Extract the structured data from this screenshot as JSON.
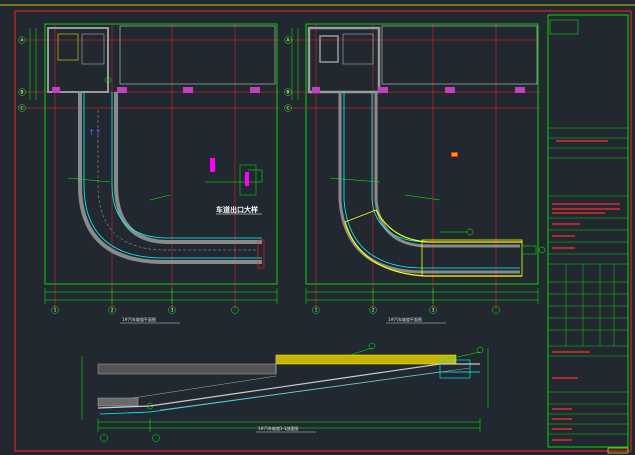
{
  "drawing": {
    "detail_callout": "车道出口大样",
    "plan_left_title": "1#汽车坡道平面图",
    "plan_right_title": "1#汽车坡道平面图",
    "section_title": "1#汽车坡道1-1剖面图",
    "axis_marks_left": [
      "A",
      "B",
      "C",
      "1",
      "2",
      "3"
    ],
    "axis_marks_right": [
      "A",
      "B",
      "C",
      "1",
      "2",
      "3"
    ],
    "title_block_rows": 8
  },
  "colors": {
    "background": "#212830",
    "border": "#ff2020",
    "grid_line": "#ff2020",
    "dimension": "#00ff00",
    "wall": "#9a9a9a",
    "ramp_edge": "#00ffff",
    "curb": "#ffff00",
    "text": "#ffffff",
    "accent": "#ff00ff"
  }
}
